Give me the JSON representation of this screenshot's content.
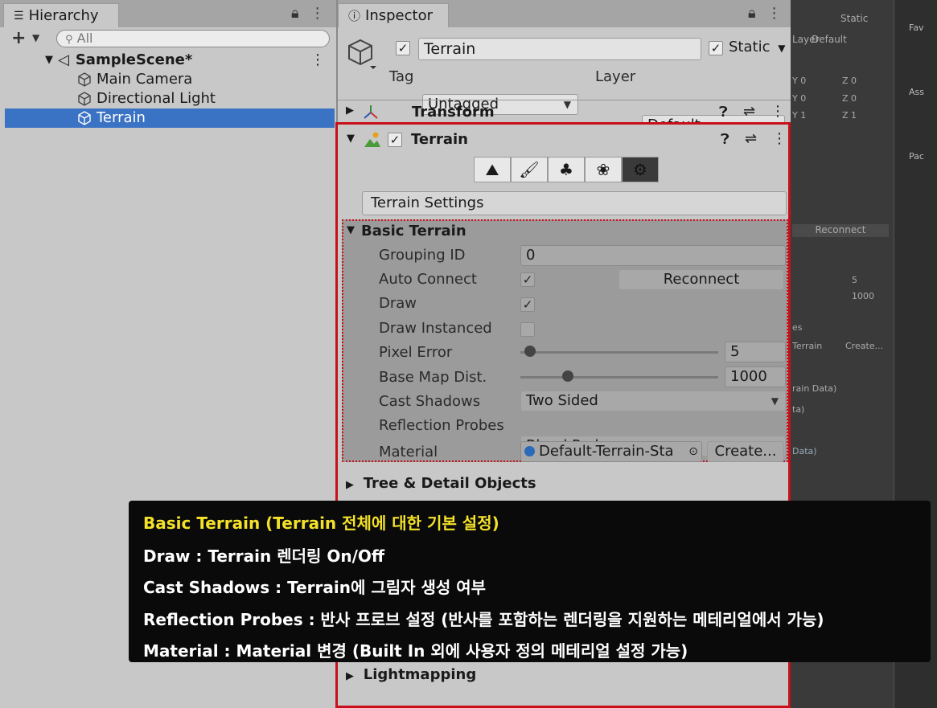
{
  "hierarchy": {
    "tab_label": "Hierarchy",
    "search_placeholder": "All",
    "scene": "SampleScene*",
    "items": [
      {
        "label": "Main Camera"
      },
      {
        "label": "Directional Light"
      },
      {
        "label": "Terrain"
      }
    ]
  },
  "inspector": {
    "tab_label": "Inspector",
    "object_name": "Terrain",
    "static_label": "Static",
    "tag_label": "Tag",
    "tag_value": "Untagged",
    "layer_label": "Layer",
    "layer_value": "Default",
    "transform_label": "Transform",
    "terrain_component_label": "Terrain",
    "settings_title": "Terrain Settings",
    "basic_terrain": {
      "header": "Basic Terrain",
      "grouping_id_label": "Grouping ID",
      "grouping_id_value": "0",
      "auto_connect_label": "Auto Connect",
      "reconnect_label": "Reconnect",
      "draw_label": "Draw",
      "draw_instanced_label": "Draw Instanced",
      "pixel_error_label": "Pixel Error",
      "pixel_error_value": "5",
      "pixel_error_fraction": 0.05,
      "base_map_label": "Base Map Dist.",
      "base_map_value": "1000",
      "base_map_fraction": 0.24,
      "cast_shadows_label": "Cast Shadows",
      "cast_shadows_value": "Two Sided",
      "reflection_label": "Reflection Probes",
      "reflection_value": "Blend Probes",
      "material_label": "Material",
      "material_value": "Default-Terrain-Sta",
      "create_label": "Create..."
    },
    "tree_detail_label": "Tree & Detail Objects",
    "lightmapping_label": "Lightmapping"
  },
  "background_panel": {
    "static_label": "Static",
    "layer_label": "Layer",
    "layer_value": "Default",
    "y0": "Y 0",
    "z0": "Z 0",
    "y0b": "Y 0",
    "z0b": "Z 0",
    "y1": "Y 1",
    "z1": "Z 1",
    "reconnect": "Reconnect",
    "val5": "5",
    "val1000": "1000",
    "es": "es",
    "terrain_ref": "Terrain",
    "create": "Create...",
    "rain_data": "rain Data)",
    "ta": "ta)",
    "data": "Data)",
    "fav": "Fav",
    "ass": "Ass",
    "pac": "Pac"
  },
  "overlay": {
    "lines": [
      "Basic Terrain (Terrain 전체에 대한 기본 설정)",
      "Draw : Terrain 렌더링 On/Off",
      "Cast Shadows : Terrain에 그림자 생성 여부",
      "Reflection Probes : 반사 프로브 설정 (반사를 포함하는 렌더링을 지원하는 메테리얼에서 가능)",
      "Material : Material 변경 (Built In 외에 사용자 정의 메테리얼 설정 가능)"
    ]
  },
  "colors": {
    "selection": "#3a72c4",
    "highlight_border": "#c8101a",
    "caption_highlight": "#f3e12a"
  }
}
